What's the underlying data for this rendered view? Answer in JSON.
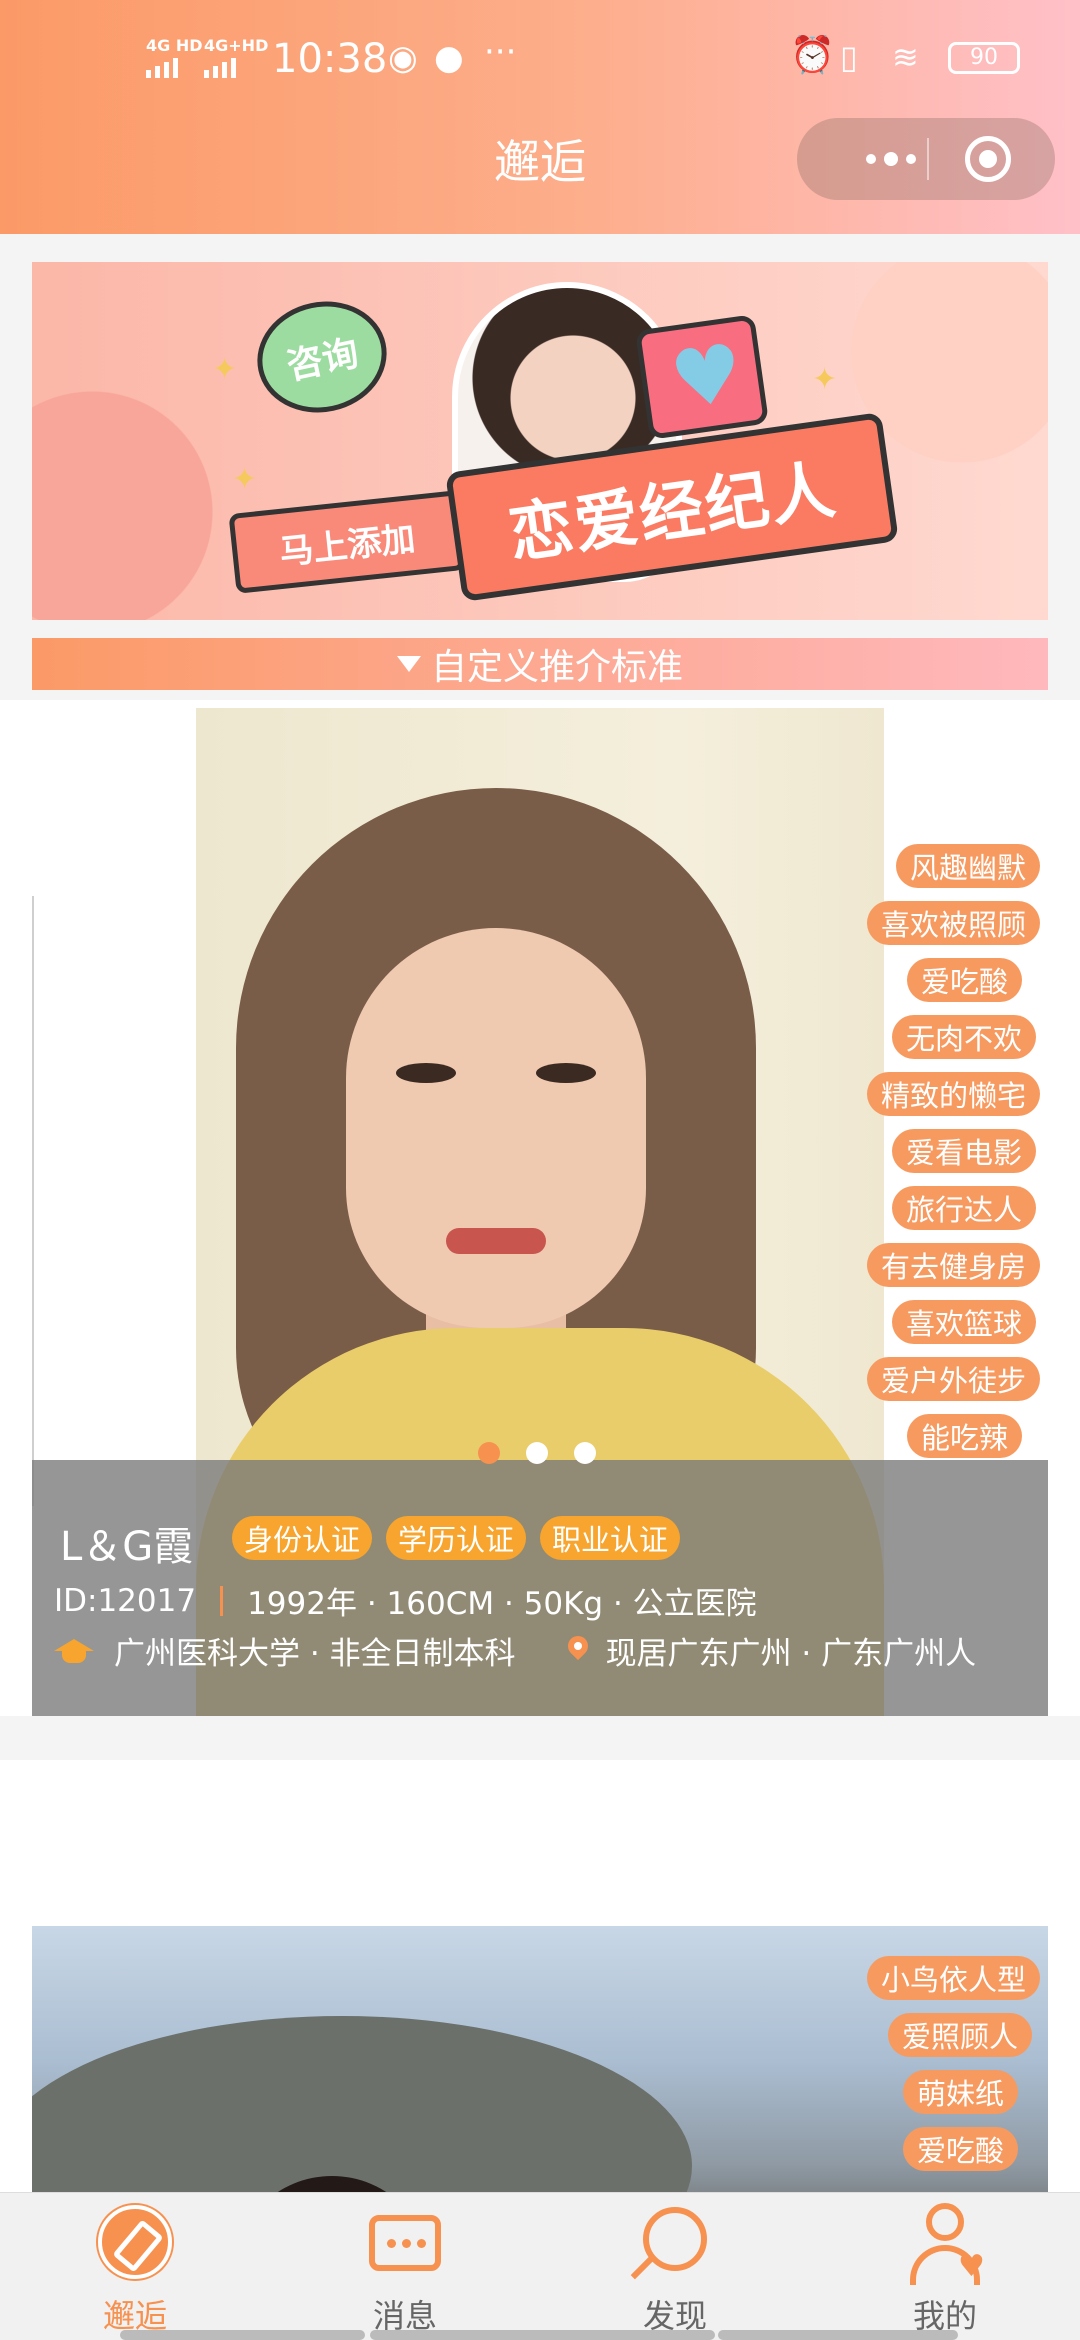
{
  "status_bar": {
    "net1": "4G HD",
    "net2": "4G+HD",
    "time": "10:38",
    "more": "···",
    "battery": "90"
  },
  "header": {
    "title": "邂逅"
  },
  "banner": {
    "bubble": "咨询",
    "small_tag": "马上添加",
    "main_text": "恋爱经纪人"
  },
  "custom_bar": {
    "label": "自定义推介标准"
  },
  "profile1": {
    "name": "L＆G霞",
    "badges": [
      "身份认证",
      "学历认证",
      "职业认证"
    ],
    "id": "ID:12017",
    "details": "1992年 · 160CM · 50Kg · 公立医院",
    "education": "广州医科大学 · 非全日制本科",
    "location": "现居广东广州 · 广东广州人",
    "tags": [
      "风趣幽默",
      "喜欢被照顾",
      "爱吃酸",
      "无肉不欢",
      "精致的懒宅",
      "爱看电影",
      "旅行达人",
      "有去健身房",
      "喜欢篮球",
      "爱户外徒步",
      "能吃辣"
    ],
    "carousel_active": 0
  },
  "profile2": {
    "tags": [
      "小鸟依人型",
      "爱照顾人",
      "萌妹纸",
      "爱吃酸"
    ]
  },
  "tabbar": {
    "items": [
      {
        "label": "邂逅",
        "icon": "compass-icon",
        "active": true
      },
      {
        "label": "消息",
        "icon": "message-icon",
        "active": false
      },
      {
        "label": "发现",
        "icon": "search-icon",
        "active": false
      },
      {
        "label": "我的",
        "icon": "user-heart-icon",
        "active": false
      }
    ]
  },
  "colors": {
    "accent": "#f7914f",
    "badge": "#f7a52e",
    "header_start": "#fb9a67",
    "header_end": "#ffc0c8"
  }
}
